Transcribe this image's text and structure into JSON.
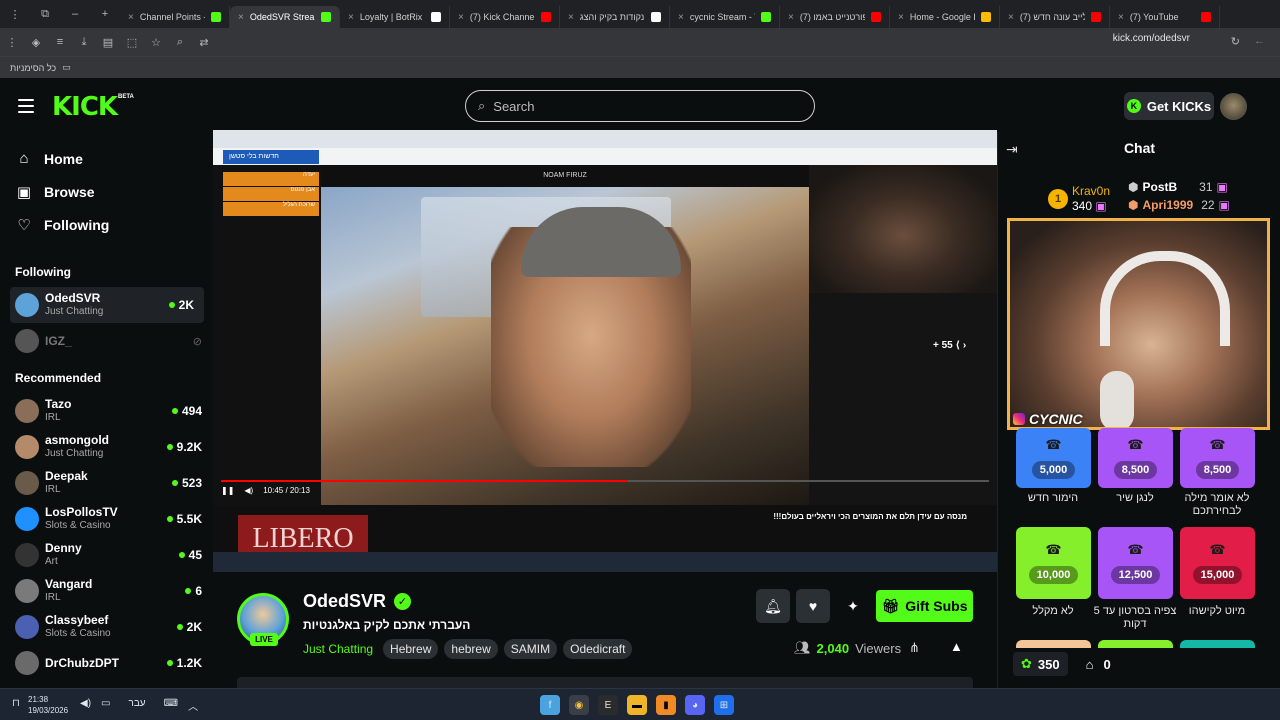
{
  "browser": {
    "tabs": [
      {
        "label": "Channel Points -",
        "color": "#53fc18"
      },
      {
        "label": "OdedSVR Stream",
        "color": "#53fc18",
        "active": true
      },
      {
        "label": "Loyalty | BotRix -",
        "color": "#ffffff"
      },
      {
        "label": "(7) Kick Channel p",
        "color": "#ff0000"
      },
      {
        "label": "נקודות בקיק והצג",
        "color": "#ffffff"
      },
      {
        "label": "cycnic Stream - V",
        "color": "#53fc18"
      },
      {
        "label": "(7) פורטנייט באמו",
        "color": "#ff0000"
      },
      {
        "label": "Home - Google D",
        "color": "#fbbc04"
      },
      {
        "label": "(7) לייב עונה חדש",
        "color": "#ff0000"
      },
      {
        "label": "(7) YouTube",
        "color": "#ff0000"
      }
    ],
    "url": "kick.com/odedsvr",
    "bookmarks_label": "כל הסימניות"
  },
  "header": {
    "logo": "KICK",
    "logo_beta": "BETA",
    "search_placeholder": "Search",
    "get_kicks": "Get KICKs"
  },
  "sidebar": {
    "nav": [
      {
        "label": "Home",
        "icon": "home-icon"
      },
      {
        "label": "Browse",
        "icon": "browse-icon"
      },
      {
        "label": "Following",
        "icon": "heart-icon"
      }
    ],
    "following_title": "Following",
    "following": [
      {
        "name": "OdedSVR",
        "category": "Just Chatting",
        "viewers": "2K",
        "color": "#5da2d8"
      },
      {
        "name": "IGZ_",
        "category": "",
        "viewers": "",
        "color": "#555555"
      }
    ],
    "recommended_title": "Recommended",
    "recommended": [
      {
        "name": "Tazo",
        "category": "IRL",
        "viewers": "494",
        "color": "#8a6e5a"
      },
      {
        "name": "asmongold",
        "category": "Just Chatting",
        "viewers": "9.2K",
        "color": "#b58a6a"
      },
      {
        "name": "Deepak",
        "category": "IRL",
        "viewers": "523",
        "color": "#6a5a4a"
      },
      {
        "name": "LosPollosTV",
        "category": "Slots & Casino",
        "viewers": "5.5K",
        "color": "#1e90ff"
      },
      {
        "name": "Denny",
        "category": "Art",
        "viewers": "45",
        "color": "#333333"
      },
      {
        "name": "Vangard",
        "category": "IRL",
        "viewers": "6",
        "color": "#7a7a7a"
      },
      {
        "name": "Classybeef",
        "category": "Slots & Casino",
        "viewers": "2K",
        "color": "#4b5fb3"
      },
      {
        "name": "DrChubzDPT",
        "category": "",
        "viewers": "1.2K",
        "color": "#6a6a6a"
      }
    ]
  },
  "player": {
    "page_tab": "חדשות בלי סטשן",
    "yt_channel": "NOAM FIRUZ",
    "time": "10:45 / 20:13",
    "progress_fraction": 0.53,
    "skip": "+ 55",
    "libero": "LIBERO",
    "yt_title": "!!!מנסה עם עידן תלם את המוצרים הכי ויראליים בעולם",
    "orange_items": [
      "יעדה",
      "אבן פנטס",
      "שרוכת הגליל"
    ]
  },
  "channel": {
    "name": "OdedSVR",
    "live": "LIVE",
    "title": "העברתי אתכם לקיק באלגנטיות",
    "category": "Just Chatting",
    "tags": [
      "Hebrew",
      "hebrew",
      "SAMIM",
      "Odedicraft"
    ],
    "gift_subs": "Gift Subs",
    "viewers_count": "2,040",
    "viewers_label": "Viewers"
  },
  "chat": {
    "title": "Chat",
    "leaders": [
      {
        "name": "Krav0n",
        "score": "340",
        "color": "#f5b400"
      },
      {
        "name": "PostB",
        "score": "31",
        "color": "#ffffff"
      },
      {
        "name": "Apri1999",
        "score": "22",
        "color": "#f39c6b"
      }
    ],
    "cam_tag": "CYCNIC",
    "rewards": [
      {
        "cost": "5,000",
        "label": "הימור חדש",
        "color": "blue"
      },
      {
        "cost": "8,500",
        "label": "לנגן שיר",
        "color": "purple"
      },
      {
        "cost": "8,500",
        "label": "לא אומר מילה לבחירתכם",
        "color": "purple"
      },
      {
        "cost": "10,000",
        "label": "לא מקלל",
        "color": "green"
      },
      {
        "cost": "12,500",
        "label": "צפיה בסרטון עד 5 דקות",
        "color": "purple"
      },
      {
        "cost": "15,000",
        "label": "מיוט לקישהו",
        "color": "red"
      }
    ],
    "points": "350",
    "gifts": "0"
  },
  "taskbar": {
    "time": "21:38",
    "date": "19/03/2026",
    "lang": "עבר"
  }
}
